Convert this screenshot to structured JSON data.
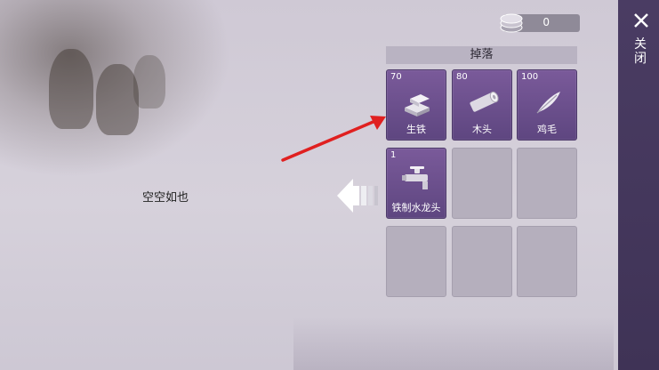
{
  "currency": {
    "value": "0",
    "icon": "coin-stack-icon"
  },
  "drop_panel": {
    "title": "掉落",
    "slots": [
      {
        "count": "70",
        "name": "生铁",
        "icon": "iron-ingot-icon"
      },
      {
        "count": "80",
        "name": "木头",
        "icon": "wood-log-icon"
      },
      {
        "count": "100",
        "name": "鸡毛",
        "icon": "feather-icon"
      },
      {
        "count": "1",
        "name": "铁制水龙头",
        "icon": "faucet-icon"
      }
    ]
  },
  "left_panel": {
    "empty_text": "空空如也"
  },
  "close": {
    "label": "关闭",
    "icon": "close-icon"
  },
  "colors": {
    "slot_filled": "#6b4f8c",
    "slot_empty": "#b5afbd",
    "close_panel": "#453859",
    "annotation_arrow": "#e02020"
  }
}
